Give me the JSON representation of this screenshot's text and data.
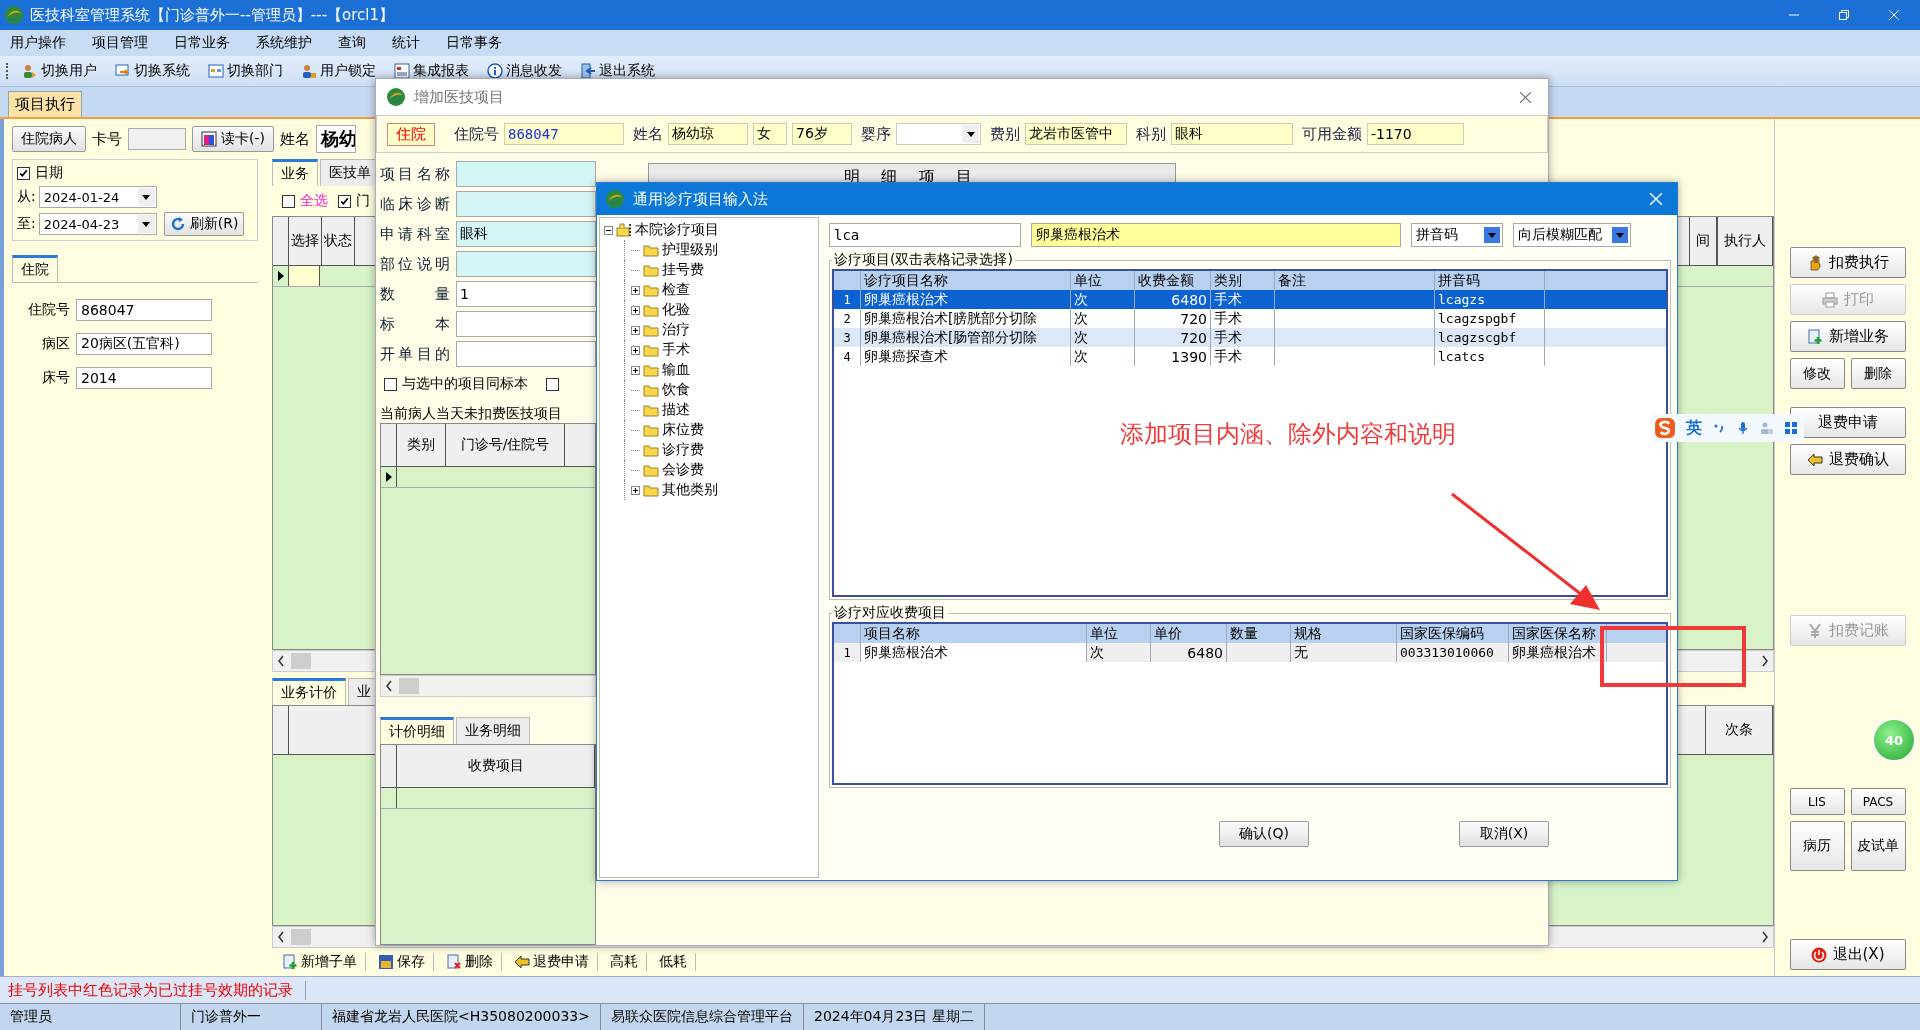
{
  "window": {
    "title": "医技科室管理系统【门诊普外一--管理员】---【orcl1】"
  },
  "menu": [
    "用户操作",
    "项目管理",
    "日常业务",
    "系统维护",
    "查询",
    "统计",
    "日常事务"
  ],
  "toolbar": [
    {
      "label": "切换用户",
      "kind": "users"
    },
    {
      "label": "切换系统",
      "kind": "switch"
    },
    {
      "label": "切换部门",
      "kind": "window"
    },
    {
      "label": "用户锁定",
      "kind": "lock"
    },
    {
      "label": "集成报表",
      "kind": "report"
    },
    {
      "label": "消息收发",
      "kind": "info"
    },
    {
      "label": "退出系统",
      "kind": "exit"
    }
  ],
  "main_tab": {
    "label": "项目执行",
    "selected": true
  },
  "patient_bar": {
    "type_button": "住院病人",
    "card_label": "卡号",
    "read_card_button": "读卡(-)",
    "name_label": "姓名",
    "name_value": "杨幼"
  },
  "date_filter": {
    "label": "日期",
    "checked": true,
    "from_label": "从:",
    "from": "2024-01-24",
    "to_label": "至:",
    "to": "2024-04-23",
    "refresh_button": "刷新(R)"
  },
  "inpatient": {
    "tab": "住院",
    "fields": [
      {
        "label": "住院号",
        "value": "868047"
      },
      {
        "label": "病区",
        "value": "20病区(五官科)"
      },
      {
        "label": "床号",
        "value": "2014"
      }
    ]
  },
  "business": {
    "tabs": [
      {
        "label": "业务",
        "selected": true
      },
      {
        "label": "医技单",
        "selected": false
      }
    ],
    "select_all": {
      "label": "全选",
      "checked": false
    },
    "filter_2": {
      "label": "门",
      "checked": true
    },
    "columns": [
      "选择",
      "状态"
    ],
    "right_columns": [
      "间",
      "执行人"
    ],
    "lower_tabs": [
      {
        "label": "业务计价",
        "selected": true
      },
      {
        "label": "业",
        "selected": false
      }
    ],
    "lower_right_column": "次条"
  },
  "bottom_toolbar": [
    {
      "label": "新增子单",
      "kind": "add"
    },
    {
      "label": "保存",
      "kind": "save"
    },
    {
      "label": "删除",
      "kind": "delete"
    },
    {
      "label": "退费申请",
      "kind": "refund"
    },
    {
      "label": "高耗",
      "kind": "plain"
    },
    {
      "label": "低耗",
      "kind": "plain"
    }
  ],
  "side_buttons": [
    {
      "label": "扣费执行",
      "kind": "hand",
      "disabled": false
    },
    {
      "label": "打印",
      "kind": "printer",
      "disabled": true
    },
    {
      "label": "新增业务",
      "kind": "add",
      "disabled": false
    },
    {
      "label": "修改",
      "kind": "small",
      "disabled": false
    },
    {
      "label": "删除",
      "kind": "small",
      "disabled": false
    },
    {
      "label": "退费申请",
      "kind": "plain",
      "disabled": false
    },
    {
      "label": "退费确认",
      "kind": "refund",
      "disabled": false
    },
    {
      "label": "扣费记账",
      "kind": "yen",
      "disabled": true
    },
    {
      "label": "LIS",
      "kind": "small",
      "disabled": false
    },
    {
      "label": "PACS",
      "kind": "small",
      "disabled": false
    },
    {
      "label": "病历",
      "kind": "tall",
      "disabled": false
    },
    {
      "label": "皮试单",
      "kind": "tall",
      "disabled": false
    },
    {
      "label": "退出(X)",
      "kind": "power",
      "disabled": false
    }
  ],
  "ime_bar": {
    "mode": "英"
  },
  "badge": "40",
  "status_message": "挂号列表中红色记录为已过挂号效期的记录",
  "status_bar": [
    "管理员",
    "门诊普外一",
    "福建省龙岩人民医院<H35080200033>",
    "易联众医院信息综合管理平台",
    "2024年04月23日 星期二"
  ],
  "add_dialog": {
    "title": "增加医技项目",
    "patient_type": "住院",
    "info": [
      {
        "label": "住院号",
        "value": "868047",
        "kind": "number"
      },
      {
        "label": "姓名",
        "value": "杨幼琼",
        "kind": "text"
      },
      {
        "value": "女",
        "kind": "text"
      },
      {
        "value": "76岁",
        "kind": "text"
      },
      {
        "label": "婴序",
        "kind": "dropdown"
      },
      {
        "label": "费别",
        "value": "龙岩市医管中",
        "kind": "text"
      },
      {
        "label": "科别",
        "value": "眼科",
        "kind": "text"
      },
      {
        "label": "可用金额",
        "value": "-1170",
        "kind": "text"
      }
    ],
    "form": [
      {
        "label": "项目名称",
        "kind": "highlight"
      },
      {
        "label": "临床诊断",
        "kind": "highlight"
      },
      {
        "label": "申请科室",
        "value": "眼科",
        "kind": "highlight"
      },
      {
        "label": "部位说明",
        "kind": "highlight"
      },
      {
        "label": "数 量",
        "value": "1",
        "kind": "plain"
      },
      {
        "label": "标 本",
        "kind": "plain"
      },
      {
        "label": "开单目的",
        "kind": "plain"
      }
    ],
    "same_specimen": {
      "label": "与选中的项目同标本",
      "checked": false
    },
    "extra_option": {
      "checked": false
    },
    "detail_header": "明 细 项 目",
    "pending": {
      "title": "当前病人当天未扣费医技项目",
      "columns": [
        "类别",
        "门诊号/住院号"
      ]
    },
    "detail_tabs": [
      {
        "label": "计价明细",
        "selected": true
      },
      {
        "label": "业务明细",
        "selected": false
      }
    ],
    "fee_columns": [
      "收费项目"
    ]
  },
  "picker_dialog": {
    "title": "通用诊疗项目输入法",
    "tree": {
      "label": "本院诊疗项目",
      "expanded": true,
      "children": [
        {
          "label": "护理级别",
          "expandable": false
        },
        {
          "label": "挂号费",
          "expandable": false
        },
        {
          "label": "检查",
          "expandable": true
        },
        {
          "label": "化验",
          "expandable": true
        },
        {
          "label": "治疗",
          "expandable": true
        },
        {
          "label": "手术",
          "expandable": true
        },
        {
          "label": "输血",
          "expandable": true
        },
        {
          "label": "饮食",
          "expandable": false
        },
        {
          "label": "描述",
          "expandable": false
        },
        {
          "label": "床位费",
          "expandable": false
        },
        {
          "label": "诊疗费",
          "expandable": false
        },
        {
          "label": "会诊费",
          "expandable": false
        },
        {
          "label": "其他类别",
          "expandable": true
        }
      ]
    },
    "search": {
      "code": "lca",
      "name": "卵巢癌根治术",
      "code_type": "拼音码",
      "match_mode": "向后模糊匹配"
    },
    "items": {
      "title": "诊疗项目(双击表格记录选择)",
      "columns": [
        "诊疗项目名称",
        "单位",
        "收费金额",
        "类别",
        "备注",
        "拼音码"
      ],
      "rows": [
        {
          "no": "1",
          "name": "卵巢癌根治术",
          "unit": "次",
          "amount": "6480",
          "category": "手术",
          "pinyin": "lcagzs",
          "selected": true
        },
        {
          "no": "2",
          "name": "卵巢癌根治术[膀胱部分切除",
          "unit": "次",
          "amount": "720",
          "category": "手术",
          "pinyin": "lcagzspgbf",
          "selected": false
        },
        {
          "no": "3",
          "name": "卵巢癌根治术[肠管部分切除",
          "unit": "次",
          "amount": "720",
          "category": "手术",
          "pinyin": "lcagzscgbf",
          "selected": false
        },
        {
          "no": "4",
          "name": "卵巢癌探查术",
          "unit": "次",
          "amount": "1390",
          "category": "手术",
          "pinyin": "lcatcs",
          "selected": false
        }
      ]
    },
    "fees": {
      "title": "诊疗对应收费项目",
      "columns": [
        "项目名称",
        "单位",
        "单价",
        "数量",
        "规格",
        "国家医保编码",
        "国家医保名称"
      ],
      "rows": [
        {
          "no": "1",
          "name": "卵巢癌根治术",
          "unit": "次",
          "price": "6480",
          "spec": "无",
          "code": "003313010060",
          "insurance_name": "卵巢癌根治术"
        }
      ]
    },
    "buttons": [
      "确认(Q)",
      "取消(X)"
    ]
  },
  "annotation": {
    "text": "添加项目内涵、除外内容和说明"
  }
}
